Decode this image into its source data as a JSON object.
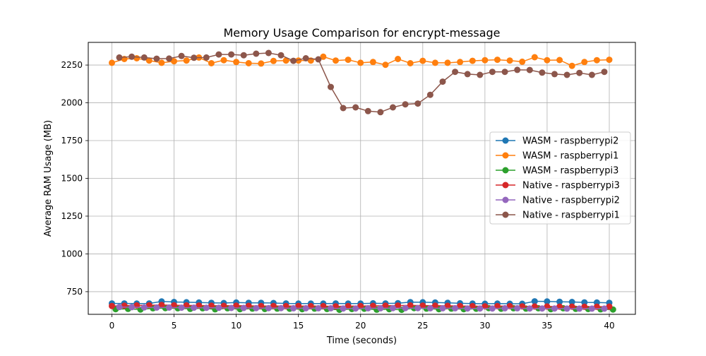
{
  "chart_data": {
    "type": "line",
    "title": "Memory Usage Comparison for encrypt-message",
    "xlabel": "Time (seconds)",
    "ylabel": "Average RAM Usage (MB)",
    "xlim": [
      -1.9,
      42.1
    ],
    "ylim": [
      600,
      2400
    ],
    "xticks": [
      0,
      5,
      10,
      15,
      20,
      25,
      30,
      35,
      40
    ],
    "yticks": [
      750,
      1000,
      1250,
      1500,
      1750,
      2000,
      2250
    ],
    "grid": true,
    "legend_position": "center-right",
    "series": [
      {
        "name": "WASM - raspberrypi2",
        "color": "#1f77b4",
        "x": [
          0,
          1,
          2,
          3,
          4,
          5,
          6,
          7,
          8,
          9,
          10,
          11,
          12,
          13,
          14,
          15,
          16,
          17,
          18,
          19,
          20,
          21,
          22,
          23,
          24,
          25,
          26,
          27,
          28,
          29,
          30,
          31,
          32,
          33,
          34,
          35,
          36,
          37,
          38,
          39,
          40
        ],
        "y": [
          672,
          672,
          671,
          672,
          685,
          682,
          680,
          678,
          676,
          675,
          678,
          676,
          676,
          675,
          672,
          671,
          671,
          671,
          672,
          671,
          671,
          673,
          672,
          674,
          681,
          680,
          678,
          676,
          673,
          671,
          670,
          671,
          670,
          670,
          686,
          685,
          683,
          682,
          679,
          678,
          676
        ]
      },
      {
        "name": "WASM - raspberrypi1",
        "color": "#ff7f0e",
        "x": [
          0,
          1,
          2,
          3,
          4,
          5,
          6,
          7,
          8,
          9,
          10,
          11,
          12,
          13,
          14,
          15,
          16,
          17,
          18,
          19,
          20,
          21,
          22,
          23,
          24,
          25,
          26,
          27,
          28,
          29,
          30,
          31,
          32,
          33,
          34,
          35,
          36,
          37,
          38,
          39,
          40
        ],
        "y": [
          2265,
          2290,
          2295,
          2280,
          2265,
          2275,
          2280,
          2300,
          2262,
          2282,
          2270,
          2262,
          2260,
          2277,
          2280,
          2280,
          2280,
          2305,
          2280,
          2285,
          2265,
          2270,
          2252,
          2290,
          2262,
          2278,
          2265,
          2265,
          2270,
          2278,
          2282,
          2285,
          2280,
          2272,
          2302,
          2282,
          2283,
          2245,
          2270,
          2282,
          2285
        ]
      },
      {
        "name": "WASM - raspberrypi3",
        "color": "#2ca02c",
        "x": [
          0.3,
          1.3,
          2.3,
          3.3,
          4.3,
          5.3,
          6.3,
          7.3,
          8.3,
          9.3,
          10.3,
          11.3,
          12.3,
          13.3,
          14.3,
          15.3,
          16.3,
          17.3,
          18.3,
          19.3,
          20.3,
          21.3,
          22.3,
          23.3,
          24.3,
          25.3,
          26.3,
          27.3,
          28.3,
          29.3,
          30.3,
          31.3,
          32.3,
          33.3,
          34.3,
          35.3,
          36.3,
          37.3,
          38.3,
          39.3,
          40.3
        ],
        "y": [
          634,
          636,
          632,
          640,
          641,
          640,
          636,
          640,
          633,
          640,
          634,
          638,
          635,
          638,
          637,
          634,
          638,
          635,
          630,
          635,
          637,
          631,
          634,
          630,
          641,
          638,
          634,
          638,
          634,
          637,
          641,
          637,
          640,
          638,
          640,
          634,
          640,
          636,
          635,
          633,
          632
        ]
      },
      {
        "name": "Native - raspberrypi3",
        "color": "#d62728",
        "x": [
          0,
          1,
          2,
          3,
          4,
          5,
          6,
          7,
          8,
          9,
          10,
          11,
          12,
          13,
          14,
          15,
          16,
          17,
          18,
          19,
          20,
          21,
          22,
          23,
          24,
          25,
          26,
          27,
          28,
          29,
          30,
          31,
          32,
          33,
          34,
          35,
          36,
          37,
          38,
          39,
          40
        ],
        "y": [
          655,
          657,
          659,
          660,
          662,
          660,
          659,
          658,
          657,
          656,
          657,
          656,
          655,
          655,
          654,
          655,
          654,
          654,
          653,
          654,
          655,
          656,
          657,
          658,
          659,
          658,
          657,
          656,
          655,
          654,
          653,
          654,
          654,
          653,
          652,
          652,
          651,
          651,
          650,
          650,
          651
        ]
      },
      {
        "name": "Native - raspberrypi2",
        "color": "#9467bd",
        "x": [
          0.6,
          1.6,
          2.6,
          3.6,
          4.6,
          5.6,
          6.6,
          7.6,
          8.6,
          9.6,
          10.6,
          11.6,
          12.6,
          13.6,
          14.6,
          15.6,
          16.6,
          17.6,
          18.6,
          19.6,
          20.6,
          21.6,
          22.6,
          23.6,
          24.6,
          25.6,
          26.6,
          27.6,
          28.6,
          29.6,
          30.6,
          31.6,
          32.6,
          33.6,
          34.6,
          35.6,
          36.6,
          37.6,
          38.6,
          39.6
        ],
        "y": [
          648,
          647,
          646,
          645,
          645,
          644,
          644,
          643,
          643,
          642,
          642,
          641,
          641,
          641,
          640,
          640,
          640,
          640,
          639,
          639,
          640,
          640,
          641,
          641,
          641,
          640,
          640,
          640,
          639,
          639,
          639,
          640,
          640,
          639,
          639,
          639,
          638,
          638,
          638,
          638
        ]
      },
      {
        "name": "Native - raspberrypi1",
        "color": "#8c564b",
        "x": [
          0.6,
          1.6,
          2.6,
          3.6,
          4.6,
          5.6,
          6.6,
          7.6,
          8.6,
          9.6,
          10.6,
          11.6,
          12.6,
          13.6,
          14.6,
          15.6,
          16.6,
          17.6,
          18.6,
          19.6,
          20.6,
          21.6,
          22.6,
          23.6,
          24.6,
          25.6,
          26.6,
          27.6,
          28.6,
          29.6,
          30.6,
          31.6,
          32.6,
          33.6,
          34.6,
          35.6,
          36.6,
          37.6,
          38.6,
          39.6
        ],
        "y": [
          2300,
          2305,
          2300,
          2292,
          2293,
          2310,
          2298,
          2300,
          2320,
          2320,
          2315,
          2325,
          2330,
          2315,
          2278,
          2295,
          2288,
          2105,
          1965,
          1970,
          1945,
          1938,
          1970,
          1990,
          1995,
          2053,
          2140,
          2205,
          2190,
          2185,
          2205,
          2205,
          2218,
          2217,
          2200,
          2190,
          2185,
          2198,
          2185,
          2205
        ]
      }
    ]
  }
}
